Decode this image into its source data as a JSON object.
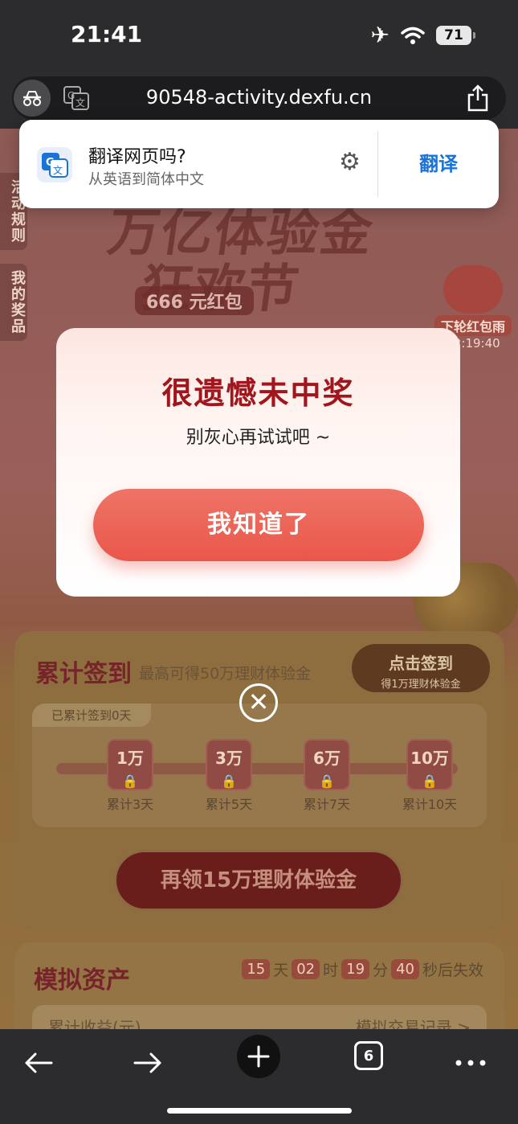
{
  "status_bar": {
    "time": "21:41",
    "battery": "71"
  },
  "url_bar": {
    "url": "90548-activity.dexfu.cn"
  },
  "translate_banner": {
    "title": "翻译网页吗?",
    "subtitle": "从英语到简体中文",
    "button": "翻译"
  },
  "page": {
    "hero_title_line1": "万亿体验金",
    "hero_title_line2": "狂欢节",
    "hero_sub": "666 元红包",
    "side_tab_rules": "活动规则",
    "side_tab_prizes": "我的奖品",
    "redpack_label": "下轮红包雨",
    "redpack_timer": "12:19:40",
    "signin": {
      "title": "累计签到",
      "subtitle": "最高可得50万理财体验金",
      "button_line1": "点击签到",
      "button_line2": "得1万理财体验金",
      "progress_tag": "已累计签到0天",
      "milestones": [
        {
          "amount": "1万",
          "label": "累计3天"
        },
        {
          "amount": "3万",
          "label": "累计5天"
        },
        {
          "amount": "6万",
          "label": "累计7天"
        },
        {
          "amount": "10万",
          "label": "累计10天"
        }
      ],
      "claim_button": "再领15万理财体验金"
    },
    "assets": {
      "title": "模拟资产",
      "countdown": {
        "days": "15",
        "days_unit": "天",
        "hours": "02",
        "hours_unit": "时",
        "minutes": "19",
        "minutes_unit": "分",
        "seconds": "40",
        "seconds_unit": "秒后失效"
      },
      "row_left": "累计收益(元)",
      "row_right": "模拟交易记录 >"
    }
  },
  "modal": {
    "title": "很遗憾未中奖",
    "subtitle": "别灰心再试试吧 ~",
    "button": "我知道了"
  },
  "toolbar": {
    "tab_count": "6"
  }
}
